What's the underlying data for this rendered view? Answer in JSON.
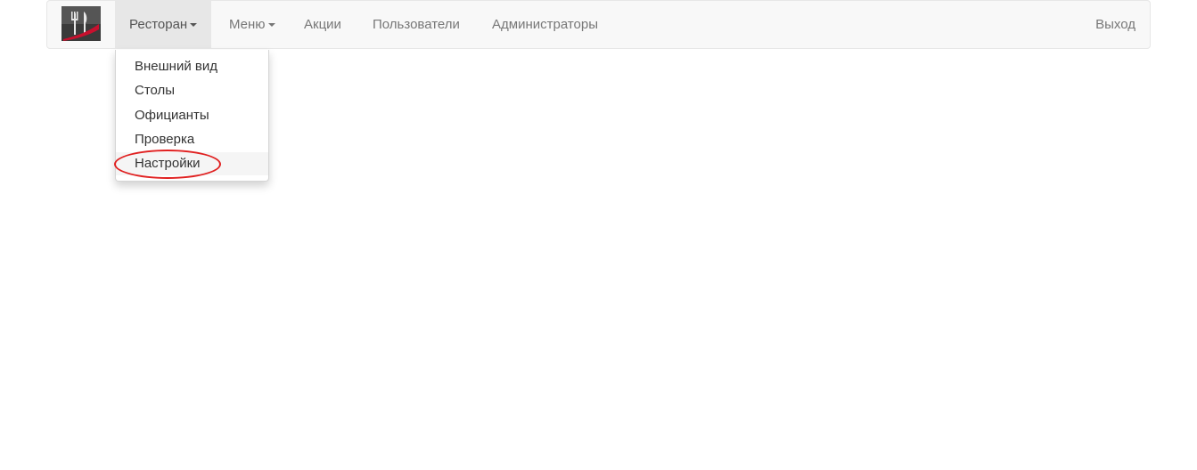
{
  "navbar": {
    "brand_icon": "fork-knife-logo-icon",
    "items": [
      {
        "label": "Ресторан",
        "has_caret": true,
        "active": true
      },
      {
        "label": "Меню",
        "has_caret": true,
        "active": false
      },
      {
        "label": "Акции",
        "has_caret": false,
        "active": false
      },
      {
        "label": "Пользователи",
        "has_caret": false,
        "active": false
      },
      {
        "label": "Администраторы",
        "has_caret": false,
        "active": false
      }
    ],
    "logout_label": "Выход"
  },
  "dropdown": {
    "items": [
      {
        "label": "Внешний вид"
      },
      {
        "label": "Столы"
      },
      {
        "label": "Официанты"
      },
      {
        "label": "Проверка"
      },
      {
        "label": "Настройки",
        "hovered": true
      }
    ]
  },
  "colors": {
    "navbar_bg": "#f8f8f8",
    "active_bg": "#e7e7e7",
    "highlight": "#e02020",
    "logo_accent": "#c8102e"
  }
}
